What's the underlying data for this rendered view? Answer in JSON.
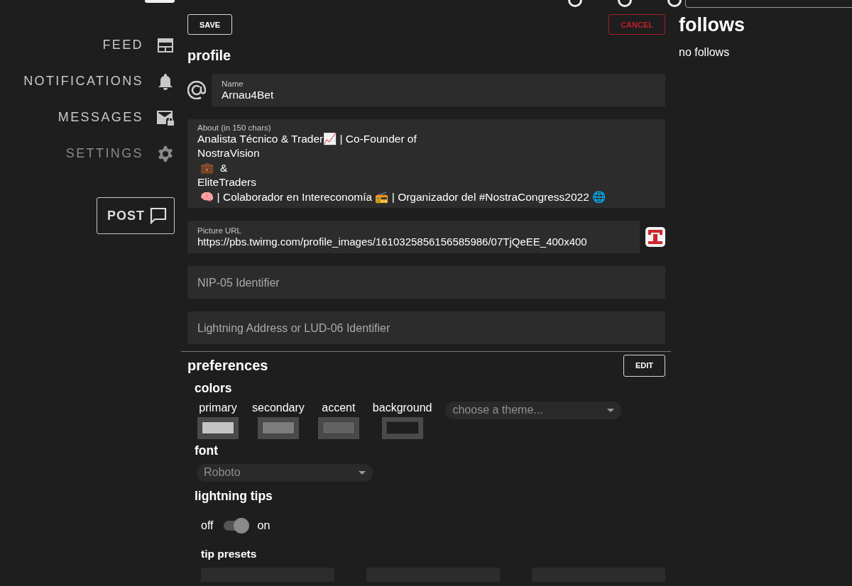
{
  "nav": {
    "items": [
      {
        "label": "FEED",
        "kind": "feed",
        "selected": false
      },
      {
        "label": "NOTIFICATIONS",
        "kind": "bell",
        "selected": false
      },
      {
        "label": "MESSAGES",
        "kind": "mail",
        "selected": false
      },
      {
        "label": "SETTINGS",
        "kind": "gear",
        "selected": true
      }
    ],
    "post_button": "POST"
  },
  "actions": {
    "save": "SAVE",
    "cancel": "CANCEL"
  },
  "profile": {
    "title": "profile",
    "name": {
      "label": "Name",
      "value": "Arnau4Bet"
    },
    "about": {
      "label": "About (in 150 chars)",
      "value": "Analista Técnico & Trader📈 | Co-Founder of\nNostraVision\n 💼  &\nEliteTraders\n 🧠 | Colaborador en Intereconomía 📻 | Organizador del #NostraCongress2022 🌐"
    },
    "picture": {
      "label": "Picture URL",
      "value": "https://pbs.twimg.com/profile_images/1610325856156585986/07TjQeEE_400x400"
    },
    "nip05": {
      "placeholder": "NIP-05 Identifier"
    },
    "lud06": {
      "placeholder": "Lightning Address or LUD-06 Identifier"
    }
  },
  "preferences": {
    "title": "preferences",
    "edit": "EDIT",
    "colors_title": "colors",
    "colors": [
      {
        "label": "primary",
        "color": "#c4c4c4"
      },
      {
        "label": "secondary",
        "color": "#7c7c7c"
      },
      {
        "label": "accent",
        "color": "#626262"
      },
      {
        "label": "background",
        "color": "#1e1e1e"
      }
    ],
    "theme": {
      "placeholder": "choose a theme..."
    },
    "font_title": "font",
    "font": {
      "value": "Roboto"
    },
    "tips_title": "lightning tips",
    "tips_toggle": {
      "off_label": "off",
      "on_label": "on",
      "on": true
    },
    "presets_title": "tip presets"
  },
  "follows": {
    "title": "follows",
    "empty": "no follows"
  }
}
